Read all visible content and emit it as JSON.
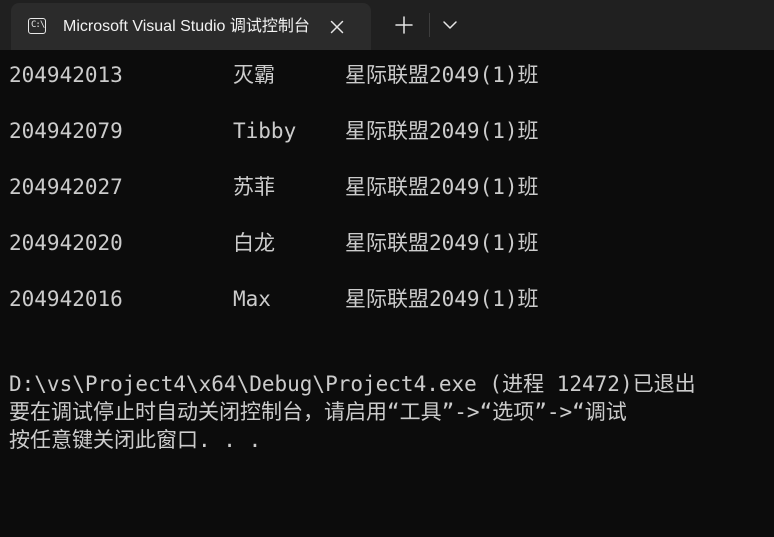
{
  "tab": {
    "icon": "terminal-icon",
    "title": "Microsoft Visual Studio 调试控制台",
    "close_icon": "close-icon",
    "new_tab_icon": "plus-icon",
    "dropdown_icon": "chevron-down-icon"
  },
  "students": [
    {
      "id": "204942013",
      "name": "灭霸",
      "class": "星际联盟2049(1)班"
    },
    {
      "id": "204942079",
      "name": "Tibby",
      "class": "星际联盟2049(1)班"
    },
    {
      "id": "204942027",
      "name": "苏菲",
      "class": "星际联盟2049(1)班"
    },
    {
      "id": "204942020",
      "name": "白龙",
      "class": "星际联盟2049(1)班"
    },
    {
      "id": "204942016",
      "name": "Max",
      "class": "星际联盟2049(1)班"
    }
  ],
  "messages": [
    "D:\\vs\\Project4\\x64\\Debug\\Project4.exe (进程 12472)已退出",
    "要在调试停止时自动关闭控制台，请启用“工具”->“选项”->“调试",
    "按任意键关闭此窗口. . ."
  ],
  "colors": {
    "console_bg": "#0c0c0c",
    "tabbar_bg": "#202020",
    "tab_active_bg": "#2b2b2b",
    "text": "#cccccc"
  }
}
